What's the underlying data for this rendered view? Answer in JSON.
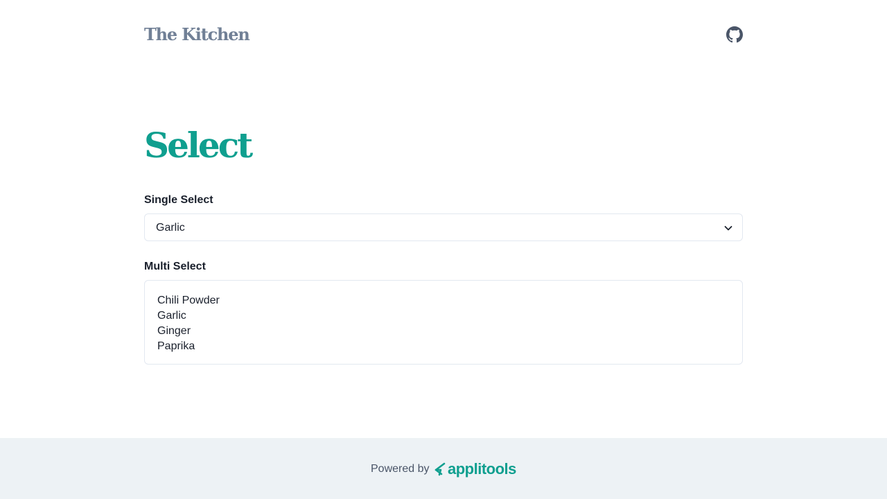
{
  "header": {
    "logo_text": "The Kitchen",
    "github_icon": "github-icon"
  },
  "page": {
    "title": "Select"
  },
  "single_select": {
    "label": "Single Select",
    "selected_value": "Garlic",
    "chevron_icon": "chevron-down-icon"
  },
  "multi_select": {
    "label": "Multi Select",
    "options": [
      "Chili Powder",
      "Garlic",
      "Ginger",
      "Paprika"
    ]
  },
  "footer": {
    "powered_by": "Powered by",
    "brand_name": "applitools",
    "brand_icon": "applitools-logo-icon",
    "brand_color": "#0f9f8f"
  },
  "colors": {
    "title": "#0f9f8f",
    "logo": "#718096",
    "footer_bg": "#edf2f5",
    "border": "#e2e8f0"
  }
}
